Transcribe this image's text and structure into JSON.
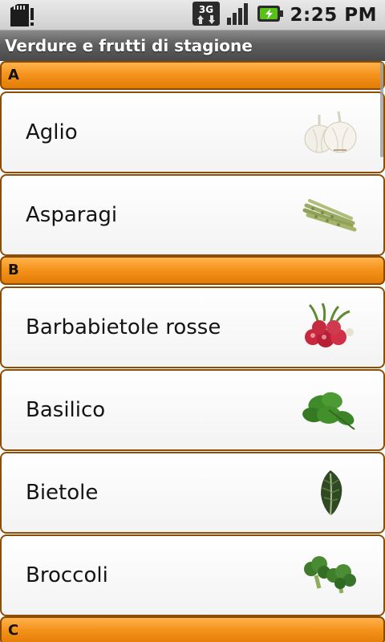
{
  "statusbar": {
    "network": "3G",
    "time": "2:25 PM",
    "icons": [
      "sd-card-alert-icon",
      "3g-data-icon",
      "signal-icon",
      "battery-charging-icon"
    ]
  },
  "title": "Verdure e frutti di stagione",
  "sections": [
    {
      "letter": "A",
      "items": [
        {
          "label": "Aglio",
          "icon": "garlic-icon"
        },
        {
          "label": "Asparagi",
          "icon": "asparagus-icon"
        }
      ]
    },
    {
      "letter": "B",
      "items": [
        {
          "label": "Barbabietole rosse",
          "icon": "radish-icon"
        },
        {
          "label": "Basilico",
          "icon": "basil-icon"
        },
        {
          "label": "Bietole",
          "icon": "chard-icon"
        },
        {
          "label": "Broccoli",
          "icon": "broccoli-icon"
        }
      ]
    },
    {
      "letter": "C",
      "items": []
    }
  ],
  "colors": {
    "section_orange": "#f5941d",
    "section_border": "#8a4a00",
    "item_border": "#8c4d07",
    "titlebar": "#5e5e5e"
  }
}
